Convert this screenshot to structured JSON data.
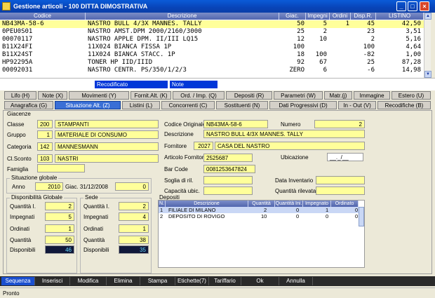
{
  "window": {
    "title": "Gestione articoli - 100 DITTA DIMOSTRATIVA"
  },
  "grid": {
    "columns": [
      "Codice",
      "Descrizione",
      "Giac.",
      "Impegni",
      "Ordini",
      "Disp.R.",
      "LISTINO"
    ],
    "rows": [
      [
        "NB43MA-58-6",
        "NASTRO BULL 4/3X MANNES. TALLY",
        "50",
        "5",
        "1",
        "45",
        "42,50"
      ],
      [
        "0PEU0S01",
        "NASTRO AMST.DPM 2000/2160/3000",
        "25",
        "2",
        "",
        "23",
        "3,51"
      ],
      [
        "00070117",
        "NASTRO APPLE DPM. II/III LQ15",
        "12",
        "10",
        "",
        "2",
        "5,16"
      ],
      [
        "B11X24FI",
        "11X024 BIANCA FISSA 1P",
        "100",
        "",
        "",
        "100",
        "4,64"
      ],
      [
        "B11X24ST",
        "11X024 BIANCA STACC. 1P",
        "18",
        "100",
        "",
        "-82",
        "1,00"
      ],
      [
        "HP92295A",
        "TONER HP IID/IIID",
        "92",
        "67",
        "",
        "25",
        "87,28"
      ],
      [
        "00092031",
        "NASTRO CENTR. PS/350/1/2/3",
        "ZERO",
        "6",
        "",
        "-6",
        "14,98"
      ]
    ]
  },
  "legend": {
    "recodified": "Recodificato",
    "note": "Note"
  },
  "tabs_row1": [
    "Lifo (H)",
    "Note (X)",
    "Movimenti (Y)",
    "Fornit.Alt. (K)",
    "Ord. / Imp. (Q)",
    "Depositi (R)",
    "Parametri (W)",
    "Matr.(j)",
    "Immagine",
    "Estero (U)"
  ],
  "tabs_row2": [
    "Anagrafica (G)",
    "Situazione Alt. (Z)",
    "Listini (L)",
    "Concorrenti (C)",
    "Sostituenti (N)",
    "Dati Progressivi (D)",
    "In - Out (V)",
    "Recodifiche (B)"
  ],
  "form": {
    "giacenze_label": "Giacenze",
    "classe_label": "Classe",
    "classe_code": "200",
    "classe_desc": "STAMPANTI",
    "gruppo_label": "Gruppo",
    "gruppo_code": "1",
    "gruppo_desc": "MATERIALE DI CONSUMO",
    "categoria_label": "Categoria",
    "categoria_code": "142",
    "categoria_desc": "MANNESMANN",
    "clsconto_label": "Cl.Sconto",
    "clsconto_code": "103",
    "clsconto_desc": "NASTRI",
    "famiglia_label": "Famiglia",
    "famiglia_value": "",
    "codice_orig_label": "Codice Originale",
    "codice_orig_value": "NB43MA-58-6",
    "numero_label": "Numero",
    "numero_value": "2",
    "descrizione_label": "Descrizione",
    "descrizione_value": "NASTRO BULL 4/3X MANNES. TALLY",
    "fornitore_label": "Fornitore",
    "fornitore_code": "2027",
    "fornitore_desc": "CASA DEL NASTRO",
    "articolo_forn_label": "Articolo Fornitore",
    "articolo_forn_value": "2525687",
    "ubicazione_label": "Ubicazione",
    "ubicazione_value": "__._/__",
    "barcode_label": "Bar Code",
    "barcode_value": "0081253647824",
    "soglia_label": "Soglia di ril.",
    "soglia_value": "",
    "data_inv_label": "Data Inventario",
    "data_inv_value": "",
    "capacita_label": "Capacità ubic.",
    "capacita_value": "",
    "qta_ril_label": "Quantità rilevata",
    "qta_ril_value": ""
  },
  "situazione": {
    "title": "Situazione globale",
    "anno_label": "Anno",
    "anno_value": "2010",
    "giac_label": "Giac. 31/12/2008",
    "giac_value": "0"
  },
  "disp_globale": {
    "title": "Disponibilità Globale",
    "rows": [
      [
        "Quantità I.",
        "2"
      ],
      [
        "Impegnati",
        "5"
      ],
      [
        "Ordinati",
        "1"
      ],
      [
        "Quantità",
        "50"
      ],
      [
        "Disponibili",
        "46"
      ]
    ]
  },
  "sede": {
    "title": "Sede",
    "rows": [
      [
        "Quantità I.",
        "2"
      ],
      [
        "Impegnati",
        "4"
      ],
      [
        "Ordinati",
        "1"
      ],
      [
        "Quantità",
        "38"
      ],
      [
        "Disponibili",
        "35"
      ]
    ]
  },
  "depositi": {
    "title": "Depositi",
    "columns": [
      "N.",
      "Descrizione",
      "Quantità",
      "Quantità Ini.",
      "Impegnato",
      "Ordinato"
    ],
    "rows": [
      [
        "1",
        "FILIALE DI MILANO",
        "2",
        "0",
        "1",
        "0"
      ],
      [
        "2",
        "DEPOSITO DI ROVIGO",
        "10",
        "0",
        "0",
        "0"
      ]
    ]
  },
  "actions": [
    "Sequenza",
    "Inserisci",
    "Modifica",
    "Elimina",
    "Stampa",
    "Etichette(7)",
    "Tariffario",
    "Ok",
    "Annulla"
  ],
  "status": "Pronto",
  "colors": {
    "accent": "#1b4fcf",
    "selected_row": "#ffff9a",
    "field": "#ffff9a",
    "recodified": "#0037d8",
    "note": "#0037d8"
  }
}
